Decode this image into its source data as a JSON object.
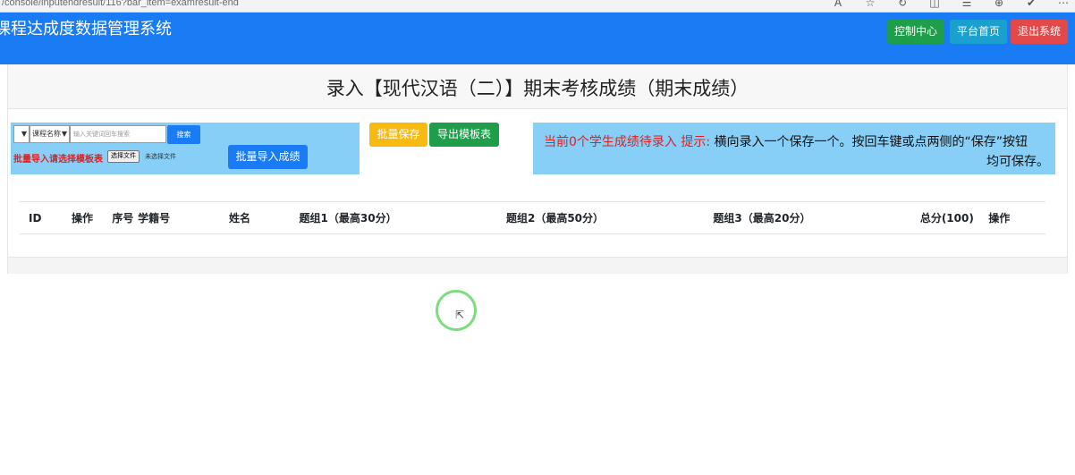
{
  "browser": {
    "url": "/console/inputendresult/116?bar_item=examresult-end",
    "icons": [
      "reader-icon",
      "star-icon",
      "refresh-icon",
      "split-icon",
      "favorites-icon",
      "collections-icon",
      "extension-icon",
      "more-icon"
    ]
  },
  "header": {
    "app_title": "课程达成度数据管理系统",
    "buttons": {
      "control_center": "控制中心",
      "platform_home": "平台首页",
      "logout": "退出系统"
    },
    "colors": {
      "bar": "#1a7cf5",
      "control": "#1e9e4a",
      "home": "#1aa0cf",
      "logout": "#e34948"
    }
  },
  "page": {
    "title": "录入【现代汉语（二）】期末考核成绩（期末成绩）"
  },
  "search": {
    "filter_selected": "课程名称",
    "placeholder": "输入关键词回车搜索",
    "search_button": "搜索",
    "import_label": "批量导入请选择模板表",
    "file_button": "选择文件",
    "file_status": "未选择文件",
    "import_button": "批量导入成绩"
  },
  "actions": {
    "batch_save": "批量保存",
    "export_template": "导出模板表"
  },
  "notice": {
    "pending_text": "当前0个学生成绩待录入",
    "hint_label": "提示:",
    "hint_text": "横向录入一个保存一个。按回车键或点两侧的“保存”按钮",
    "hint_text_2": "均可保存。"
  },
  "table": {
    "headers": [
      "ID",
      "操作",
      "序号",
      "学籍号",
      "姓名",
      "题组1（最高30分）",
      "题组2（最高50分）",
      "题组3（最高20分）",
      "总分(100)",
      "操作"
    ],
    "rows": []
  }
}
